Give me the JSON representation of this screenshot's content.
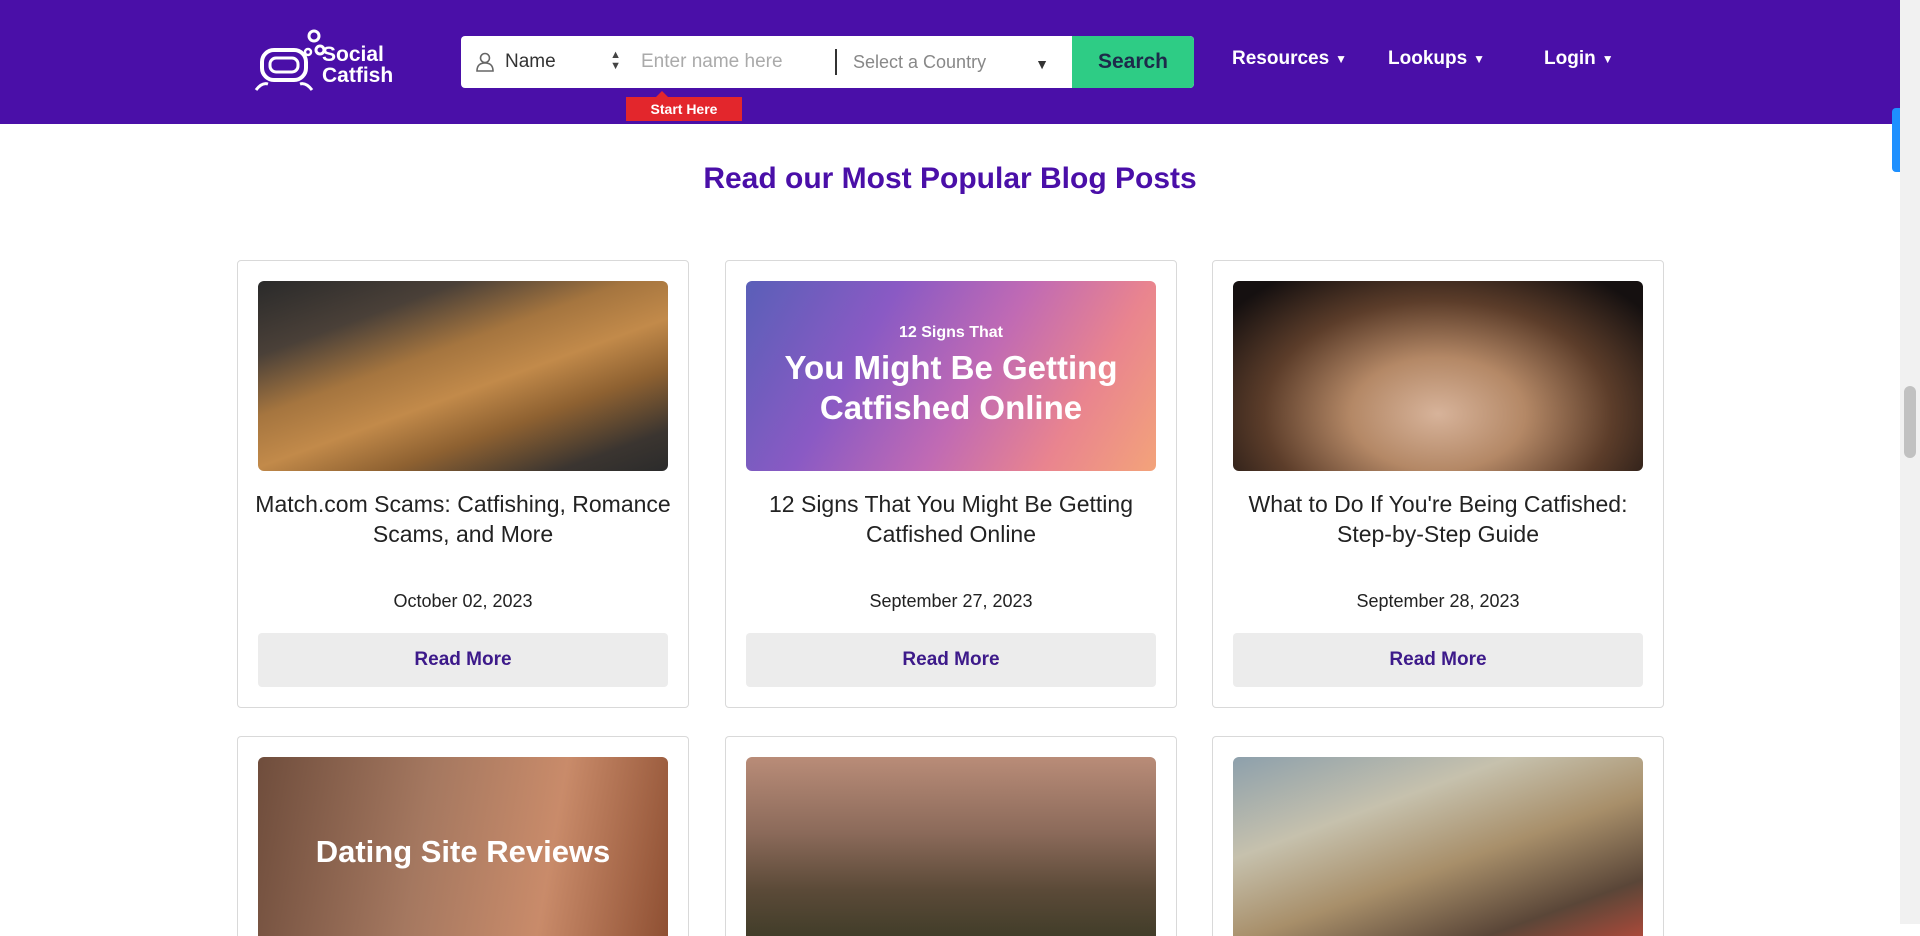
{
  "header": {
    "logo_text_line1": "Social",
    "logo_text_line2": "Catfish",
    "search": {
      "type_label": "Name",
      "name_placeholder": "Enter name here",
      "country_value": "Select a Country",
      "search_label": "Search",
      "start_here_label": "Start Here"
    },
    "nav": {
      "resources_label": "Resources",
      "lookups_label": "Lookups",
      "login_label": "Login"
    }
  },
  "main": {
    "section_title": "Read our Most Popular Blog Posts",
    "cards": [
      {
        "title": "Match.com Scams: Catfishing, Romance Scams, and More",
        "date": "October 02, 2023",
        "read_more": "Read More"
      },
      {
        "title": "12 Signs That You Might Be Getting Catfished Online",
        "date": "September 27, 2023",
        "read_more": "Read More",
        "image_top_text": "12 Signs That",
        "image_main_text": "You Might Be Getting Catfished Online"
      },
      {
        "title": "What to Do If You're Being Catfished: Step-by-Step Guide",
        "date": "September 28, 2023",
        "read_more": "Read More"
      }
    ],
    "second_row": [
      {
        "image_text": "Dating Site Reviews"
      },
      {
        "image_text": ""
      },
      {
        "image_text": ""
      }
    ]
  },
  "colors": {
    "brand_purple": "#4a0fa8",
    "search_green": "#2ecc85",
    "start_here_red": "#e3262c"
  }
}
